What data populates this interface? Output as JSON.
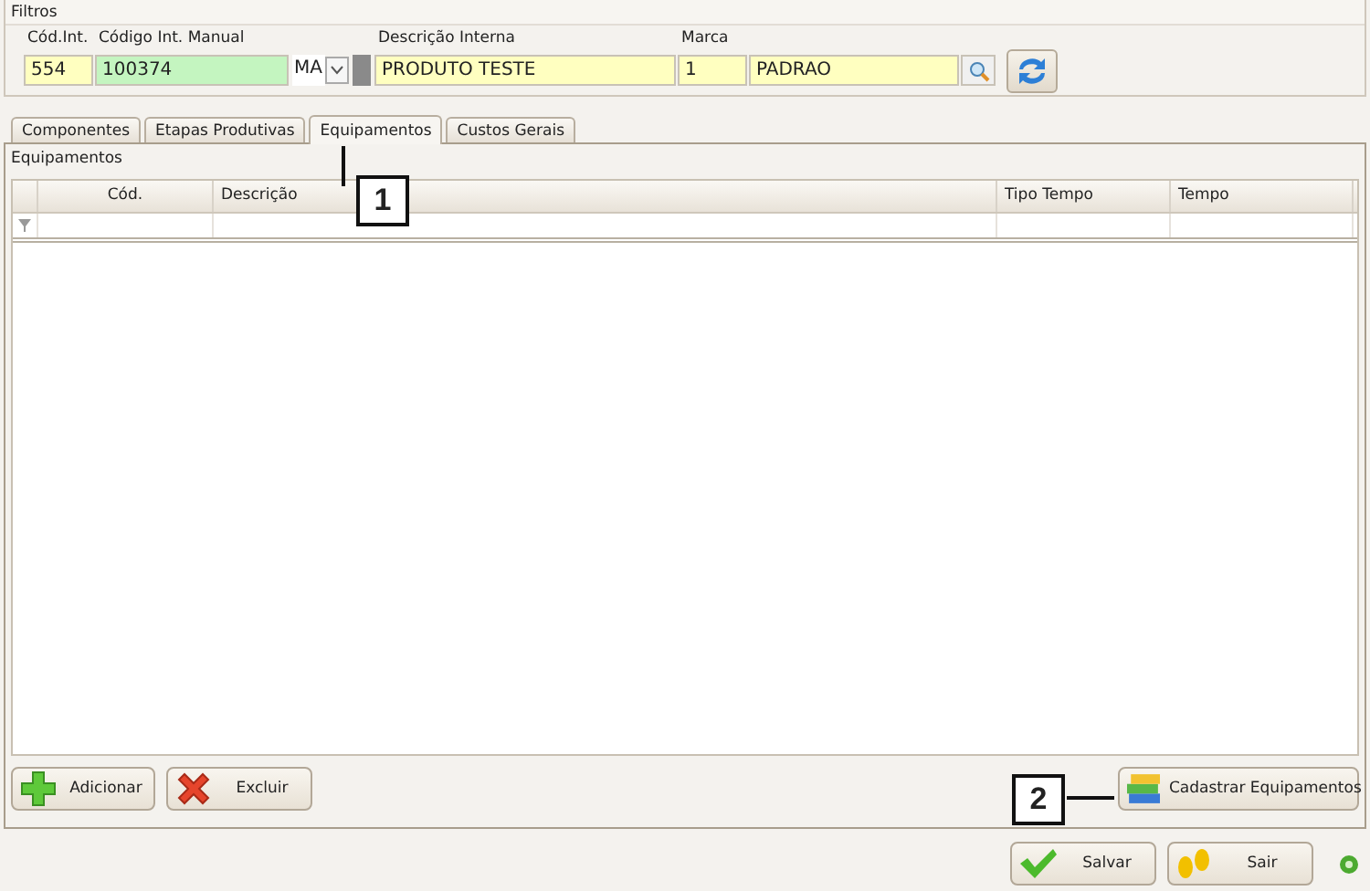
{
  "filters": {
    "title": "Filtros",
    "fields": [
      {
        "kind": "text",
        "label": "Cód.Int.",
        "value": "554",
        "color": "#ffffc0"
      },
      {
        "kind": "text",
        "label": "Código Int. Manual",
        "value": "100374",
        "color": "#c4f5c0"
      },
      {
        "kind": "combo",
        "value": "MA"
      },
      {
        "kind": "swatch"
      },
      {
        "kind": "text",
        "label": "Descrição Interna",
        "value": "PRODUTO TESTE",
        "color": "#ffffc0"
      },
      {
        "kind": "text",
        "label": "Marca",
        "value": "1",
        "color": "#ffffc0"
      },
      {
        "kind": "lookup",
        "value": "PADRAO",
        "color": "#ffffc0"
      },
      {
        "kind": "refresh"
      }
    ]
  },
  "tabs": [
    {
      "label": "Componentes",
      "selected": false
    },
    {
      "label": "Etapas Produtivas",
      "selected": false
    },
    {
      "label": "Equipamentos",
      "selected": true
    },
    {
      "label": "Custos Gerais",
      "selected": false
    }
  ],
  "grid": {
    "title": "Equipamentos",
    "columns": [
      "Cód.",
      "Descrição",
      "Tipo Tempo",
      "Tempo"
    ]
  },
  "panel_buttons": [
    {
      "kind": "add",
      "label": "Adicionar"
    },
    {
      "kind": "delete",
      "label": "Excluir"
    },
    {
      "kind": "register",
      "label": "Cadastrar Equipamentos"
    }
  ],
  "footer_buttons": [
    {
      "kind": "save",
      "label": "Salvar"
    },
    {
      "kind": "exit",
      "label": "Sair"
    }
  ],
  "callouts": [
    "1",
    "2"
  ]
}
